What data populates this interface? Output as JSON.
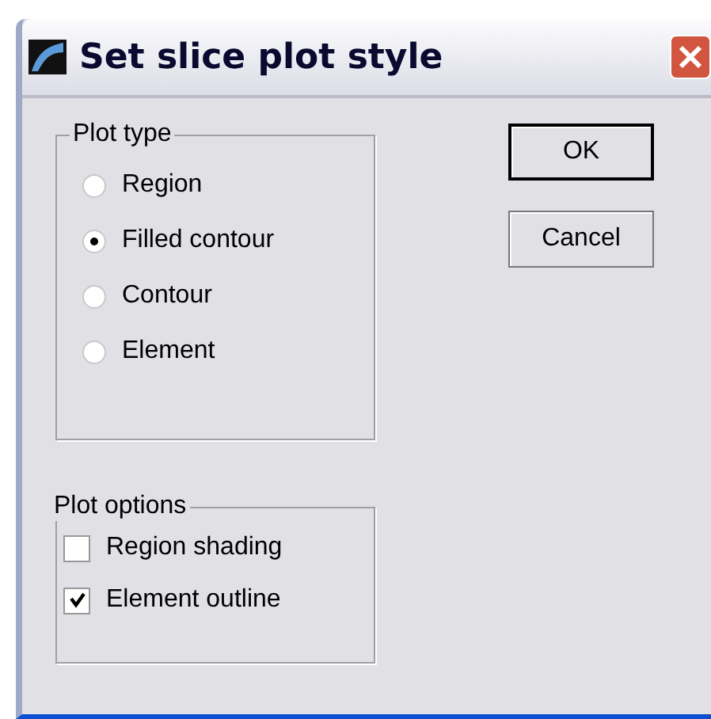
{
  "window": {
    "title": "Set slice plot style"
  },
  "plot_type": {
    "label": "Plot type",
    "options": [
      {
        "label": "Region",
        "selected": false
      },
      {
        "label": "Filled contour",
        "selected": true
      },
      {
        "label": "Contour",
        "selected": false
      },
      {
        "label": "Element",
        "selected": false
      }
    ]
  },
  "plot_options": {
    "label": "Plot options",
    "options": [
      {
        "label": "Region shading",
        "checked": false
      },
      {
        "label": "Element outline",
        "checked": true
      }
    ]
  },
  "buttons": [
    "OK",
    "Cancel"
  ]
}
